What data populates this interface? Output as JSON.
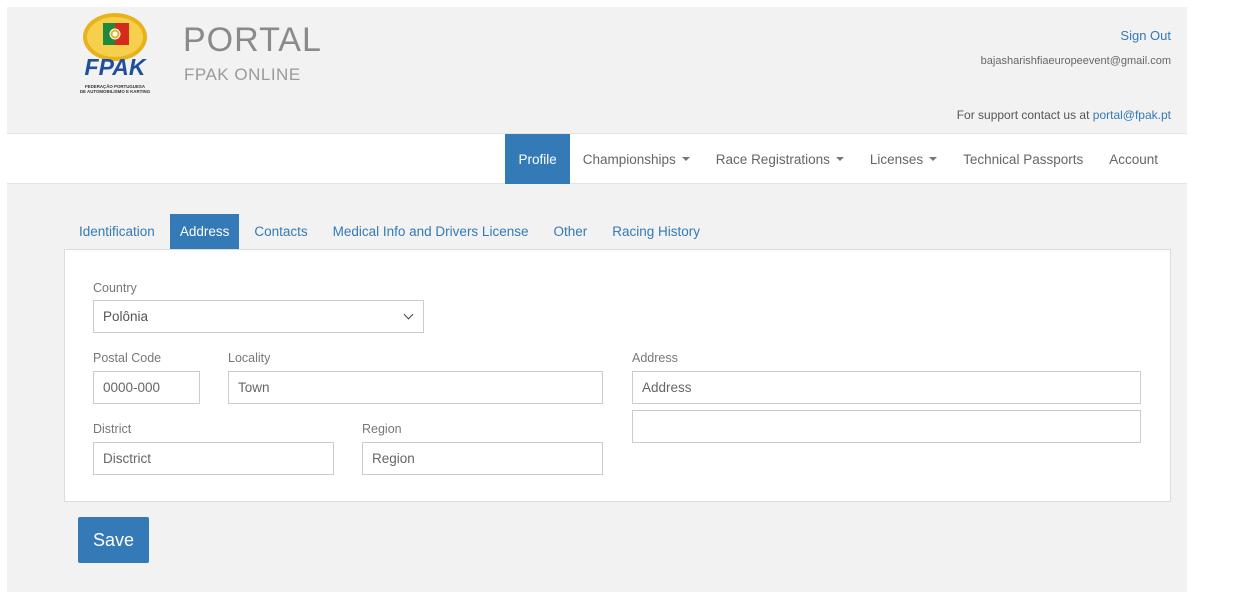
{
  "header": {
    "logo_text": "FPAK",
    "logo_caption_1": "FEDERAÇÃO PORTUGUESA",
    "logo_caption_2": "DE AUTOMOBILISMO E KARTING",
    "title": "PORTAL",
    "subtitle": "FPAK ONLINE",
    "sign_out": "Sign Out",
    "user_email": "bajasharishfiaeuropeevent@gmail.com",
    "support_text": "For support contact us at ",
    "support_email": "portal@fpak.pt"
  },
  "nav": {
    "items": [
      {
        "label": "Profile",
        "active": true,
        "dropdown": false
      },
      {
        "label": "Championships",
        "active": false,
        "dropdown": true
      },
      {
        "label": "Race Registrations",
        "active": false,
        "dropdown": true
      },
      {
        "label": "Licenses",
        "active": false,
        "dropdown": true
      },
      {
        "label": "Technical Passports",
        "active": false,
        "dropdown": false
      },
      {
        "label": "Account",
        "active": false,
        "dropdown": false
      }
    ]
  },
  "tabs": [
    {
      "label": "Identification",
      "active": false
    },
    {
      "label": "Address",
      "active": true
    },
    {
      "label": "Contacts",
      "active": false
    },
    {
      "label": "Medical Info and Drivers License",
      "active": false
    },
    {
      "label": "Other",
      "active": false
    },
    {
      "label": "Racing History",
      "active": false
    }
  ],
  "form": {
    "country_label": "Country",
    "country_value": "Polônia",
    "postal_label": "Postal Code",
    "postal_placeholder": "0000-000",
    "locality_label": "Locality",
    "locality_placeholder": "Town",
    "address_label": "Address",
    "address1_placeholder": "Address",
    "address2_value": "",
    "district_label": "District",
    "district_placeholder": "Disctrict",
    "region_label": "Region",
    "region_placeholder": "Region"
  },
  "save_label": "Save",
  "colors": {
    "accent": "#337ab7",
    "background": "#f2f2f2",
    "logo_red": "#d52b1e",
    "logo_green": "#1f8a3b",
    "logo_gold": "#e8b31a",
    "logo_blue": "#1f4e9e"
  }
}
